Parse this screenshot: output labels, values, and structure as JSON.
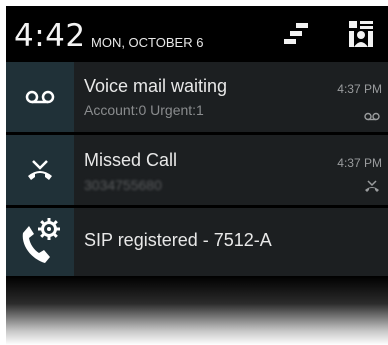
{
  "status_bar": {
    "time": "4:42",
    "date": "MON, OCTOBER 6",
    "icons": [
      "settings-bars-icon",
      "quick-settings-icon"
    ]
  },
  "notifications": [
    {
      "icon": "voicemail-icon",
      "title": "Voice mail waiting",
      "subtitle": "Account:0 Urgent:1",
      "time": "4:37 PM",
      "small_icon": "voicemail-small-icon"
    },
    {
      "icon": "missed-call-icon",
      "title": "Missed Call",
      "subtitle": "3034755680",
      "time": "4:37 PM",
      "small_icon": "missed-call-small-icon"
    },
    {
      "icon": "sip-settings-icon",
      "title": "SIP registered - 7512-A",
      "subtitle": "",
      "time": ""
    }
  ],
  "colors": {
    "panel_bg": "#1c1f21",
    "icon_bg": "#203138",
    "title_text": "#e8e8e8",
    "subtitle_text": "#8a8c8e"
  }
}
